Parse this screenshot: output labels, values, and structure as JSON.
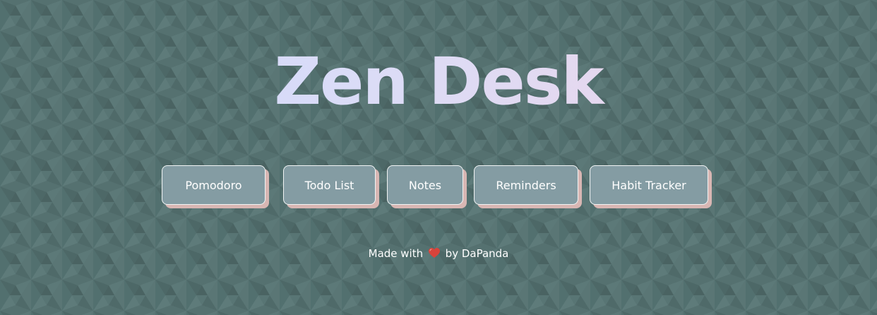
{
  "app": {
    "title": "Zen Desk"
  },
  "nav": {
    "buttons": [
      {
        "label": "Pomodoro"
      },
      {
        "label": "Todo List"
      },
      {
        "label": "Notes"
      },
      {
        "label": "Reminders"
      },
      {
        "label": "Habit Tracker"
      }
    ]
  },
  "footer": {
    "prefix": "Made with",
    "icon": "heart-icon",
    "suffix": "by DaPanda"
  },
  "colors": {
    "background": "#557170",
    "button_fill": "#849ca3",
    "button_border": "#f1f4f4",
    "button_shadow": "#d8b6b3",
    "title_gradient_start": "#cdd9ff",
    "title_gradient_end": "#f0d3e6",
    "heart": "#d9433b"
  }
}
